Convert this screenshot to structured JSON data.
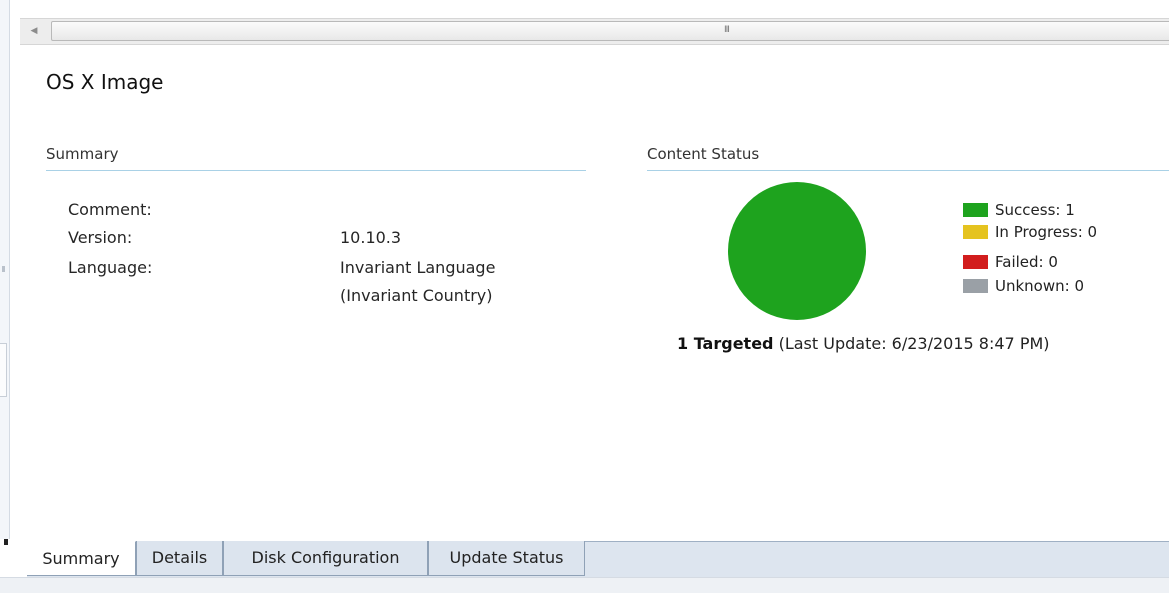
{
  "scrollbar": {
    "grip_glyph": "III",
    "left_arrow_glyph": "◀"
  },
  "page": {
    "title": "OS X Image"
  },
  "summary": {
    "header": "Summary",
    "properties": [
      {
        "label": "Comment:",
        "value": ""
      },
      {
        "label": "Version:",
        "value": "10.10.3"
      },
      {
        "label": "Language:",
        "value": "Invariant Language",
        "value_line2": "(Invariant Country)"
      }
    ]
  },
  "content_status": {
    "header": "Content Status",
    "legend": [
      {
        "label": "Success: 1",
        "color": "#1ea31e",
        "count": 1
      },
      {
        "label": "In Progress: 0",
        "color": "#e5c31f",
        "count": 0
      },
      {
        "label": "Failed: 0",
        "color": "#d21d1d",
        "count": 0
      },
      {
        "label": "Unknown: 0",
        "color": "#9aa0a6",
        "count": 0
      }
    ],
    "targeted_bold": "1 Targeted",
    "last_update": "(Last Update: 6/23/2015 8:47 PM)"
  },
  "tabs": [
    {
      "label": "Summary",
      "active": true
    },
    {
      "label": "Details",
      "active": false
    },
    {
      "label": "Disk Configuration",
      "active": false
    },
    {
      "label": "Update Status",
      "active": false
    }
  ]
}
